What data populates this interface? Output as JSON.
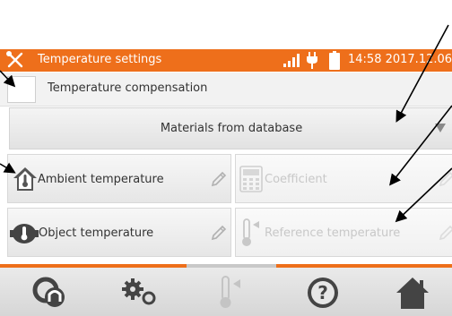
{
  "status_bar": {
    "title": "Temperature settings",
    "datetime": "14:58 2017.12.06",
    "icons": [
      "tools-icon",
      "signal-icon",
      "plug-icon",
      "battery-icon"
    ],
    "accent_color": "#ee6f1b"
  },
  "compensation": {
    "label": "Temperature compensation",
    "checked": false
  },
  "materials": {
    "label": "Materials from database",
    "icon": "dropdown-arrow-icon"
  },
  "parameters": [
    {
      "label": "Ambient temperature",
      "icon": "house-thermometer-icon",
      "enabled": true
    },
    {
      "label": "Coefficient",
      "icon": "calculator-icon",
      "enabled": false
    },
    {
      "label": "Object temperature",
      "icon": "motor-thermometer-icon",
      "enabled": true
    },
    {
      "label": "Reference temperature",
      "icon": "thermometer-icon",
      "enabled": false
    }
  ],
  "bottom_nav": [
    {
      "name": "meter-icon",
      "enabled": true
    },
    {
      "name": "settings-gears-icon",
      "enabled": true
    },
    {
      "name": "thermometer-icon",
      "enabled": false
    },
    {
      "name": "help-icon",
      "enabled": true
    },
    {
      "name": "home-icon",
      "enabled": true
    }
  ]
}
